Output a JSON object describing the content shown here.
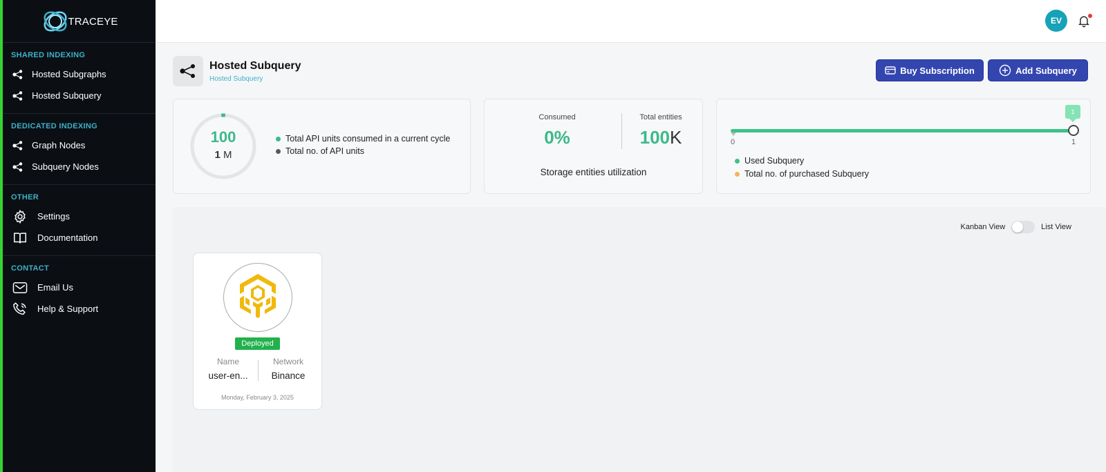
{
  "brand": {
    "name": "TRACEYE"
  },
  "sidebar": {
    "sections": [
      {
        "heading": "SHARED INDEXING",
        "items": [
          {
            "label": "Hosted Subgraphs",
            "icon": "nodes-icon"
          },
          {
            "label": "Hosted Subquery",
            "icon": "nodes-icon"
          }
        ]
      },
      {
        "heading": "DEDICATED INDEXING",
        "items": [
          {
            "label": "Graph Nodes",
            "icon": "nodes-icon"
          },
          {
            "label": "Subquery Nodes",
            "icon": "nodes-icon"
          }
        ]
      },
      {
        "heading": "OTHER",
        "items": [
          {
            "label": "Settings",
            "icon": "gear-icon"
          },
          {
            "label": "Documentation",
            "icon": "book-icon"
          }
        ]
      },
      {
        "heading": "CONTACT",
        "items": [
          {
            "label": "Email Us",
            "icon": "mail-icon"
          },
          {
            "label": "Help & Support",
            "icon": "phone-icon"
          }
        ]
      }
    ]
  },
  "topbar": {
    "avatar_initials": "EV",
    "notification_icon": "bell-icon"
  },
  "page": {
    "title": "Hosted Subquery",
    "breadcrumb": "Hosted Subquery"
  },
  "actions": {
    "buy_label": "Buy Subscription",
    "add_label": "Add Subquery"
  },
  "api_usage": {
    "consumed_value": "100",
    "total_value": "1",
    "total_unit": "M",
    "consumed_fraction": 0.0001,
    "legend_consumed": "Total API units consumed in a current cycle",
    "legend_total": "Total no. of API units",
    "colors": {
      "consumed": "#3cb98a",
      "total": "#555a5f",
      "track": "#e3e5e8"
    }
  },
  "storage": {
    "consumed_label": "Consumed",
    "consumed_value": "0%",
    "total_label": "Total entities",
    "total_number": "100",
    "total_unit": "K",
    "caption": "Storage entities utilization"
  },
  "subquery_usage": {
    "min": "0",
    "max": "1",
    "current": "1",
    "legend_used": "Used Subquery",
    "legend_purchased": "Total no. of purchased Subquery",
    "colors": {
      "used": "#3cc28a",
      "purchased": "#f0b65a"
    }
  },
  "view_toggle": {
    "kanban_label": "Kanban View",
    "list_label": "List View",
    "active": "Kanban View"
  },
  "items": [
    {
      "status": "Deployed",
      "name_label": "Name",
      "name_value": "user-en...",
      "network_label": "Network",
      "network_value": "Binance",
      "date": "Monday, February 3, 2025",
      "logo": "binance-logo"
    }
  ]
}
